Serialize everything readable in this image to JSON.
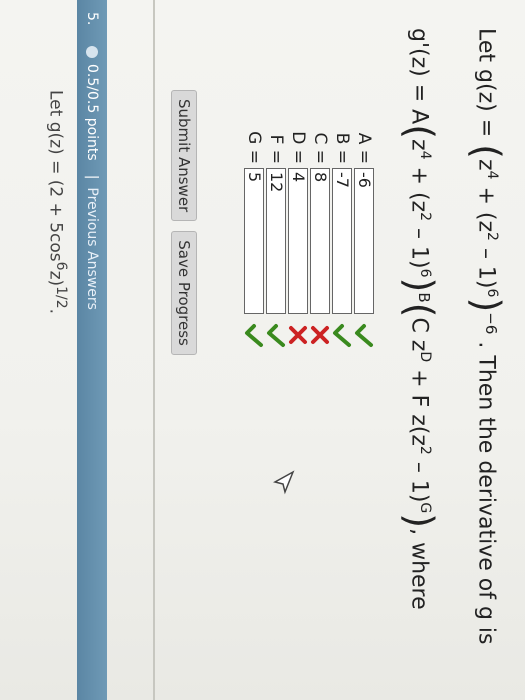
{
  "question": {
    "lead": "Let g(z) =",
    "z4": "z",
    "exp4": "4",
    "plus": "+ (z",
    "exp2a": "2",
    "minus1": "– 1)",
    "exp6a": "6",
    "outer_exp": "−6",
    "then": ". Then the derivative of g is",
    "gprime": "g'(z) = A",
    "z4b": "z",
    "exp4b": "4",
    "plus2": "+ (z",
    "exp2b": "2",
    "minus1b": "– 1)",
    "exp6b": "6",
    "bexp": "B",
    "cterm": "C z",
    "dexp": "D",
    "fterm": "+ F z(z",
    "exp2c": "2",
    "minus1c": "– 1)",
    "gexp": "G",
    "where": ", where"
  },
  "answers": [
    {
      "label": "A =",
      "value": "-6",
      "status": "correct"
    },
    {
      "label": "B =",
      "value": "-7",
      "status": "correct"
    },
    {
      "label": "C =",
      "value": "8",
      "status": "incorrect"
    },
    {
      "label": "D =",
      "value": "4",
      "status": "incorrect"
    },
    {
      "label": "F =",
      "value": "12",
      "status": "correct"
    },
    {
      "label": "G =",
      "value": "5",
      "status": "correct"
    }
  ],
  "buttons": {
    "submit": "Submit Answer",
    "save": "Save Progress"
  },
  "next_question": {
    "number": "5.",
    "points": "0.5/0.5 points",
    "separator": "|",
    "previous_answers": "Previous Answers",
    "text": "Let g(z) = (2 + 5cos",
    "exp6": "6",
    "text2": "z)",
    "exp12": "1/2",
    "end": "."
  },
  "colors": {
    "correct": "#3a8a1e",
    "incorrect": "#cc2222",
    "bar": "#5b86a4"
  }
}
